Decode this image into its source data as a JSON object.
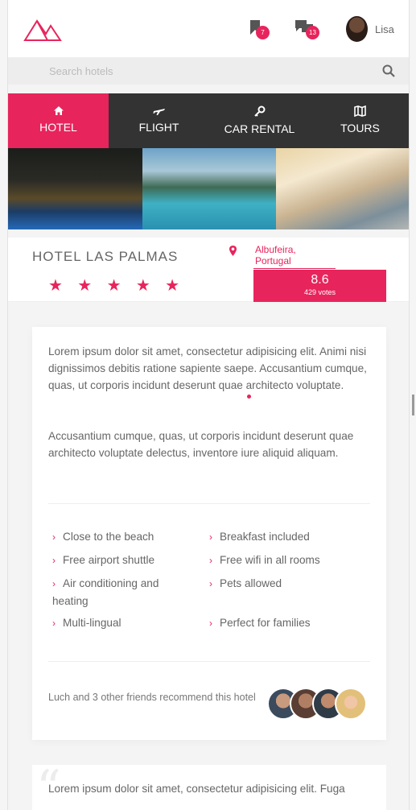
{
  "header": {
    "bookmark_count": "7",
    "messages_count": "13",
    "user_name": "Lisa"
  },
  "search": {
    "placeholder": "Search hotels"
  },
  "tabs": [
    {
      "label": "HOTEL",
      "icon": "home-icon",
      "active": true
    },
    {
      "label": "FLIGHT",
      "icon": "plane-icon",
      "active": false
    },
    {
      "label": "CAR RENTAL",
      "icon": "key-icon",
      "active": false
    },
    {
      "label": "TOURS",
      "icon": "map-icon",
      "active": false
    }
  ],
  "hotel": {
    "name": "HOTEL LAS PALMAS",
    "stars": "★ ★ ★ ★ ★",
    "location": "Albufeira, Portugal",
    "score": "8.6",
    "votes": "429 votes"
  },
  "description": {
    "paragraph1": "Lorem ipsum dolor sit amet, consectetur adipisicing elit. Animi nisi dignissimos debitis ratione sapiente saepe. Accusantium cumque, quas, ut corporis incidunt deserunt quae architecto voluptate.",
    "paragraph2": "Accusantium cumque, quas, ut corporis incidunt deserunt quae architecto voluptate delectus, inventore iure aliquid aliquam."
  },
  "amenities": [
    "Close to the beach",
    "Breakfast included",
    "Free airport shuttle",
    "Free wifi in all rooms",
    "Air conditioning and heating",
    "Pets allowed",
    "Multi-lingual",
    "Perfect for families"
  ],
  "recommend": {
    "text": "Luch and 3 other friends recommend this hotel"
  },
  "review": {
    "text": "Lorem ipsum dolor sit amet, consectetur adipisicing elit. Fuga"
  },
  "colors": {
    "accent": "#e8245c",
    "tabbar": "#333333"
  }
}
